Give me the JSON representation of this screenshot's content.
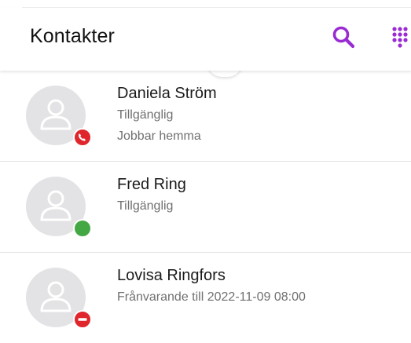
{
  "header": {
    "title": "Kontakter",
    "search_icon": "search-icon",
    "dialpad_icon": "dialpad-icon"
  },
  "colors": {
    "accent": "#9a2bd3",
    "busy": "#e0262d",
    "available": "#43a843",
    "avatar_bg": "#e3e3e5",
    "secondary_text": "#707070"
  },
  "contacts": [
    {
      "name": "Daniela Ström",
      "status": "Tillgänglig",
      "note": "Jobbar hemma",
      "presence_icon": "phone-busy-icon"
    },
    {
      "name": "Fred Ring",
      "status": "Tillgänglig",
      "note": "",
      "presence_icon": "available-dot-icon"
    },
    {
      "name": "Lovisa Ringfors",
      "status": "Frånvarande till 2022-11-09 08:00",
      "note": "",
      "presence_icon": "do-not-disturb-icon"
    }
  ]
}
